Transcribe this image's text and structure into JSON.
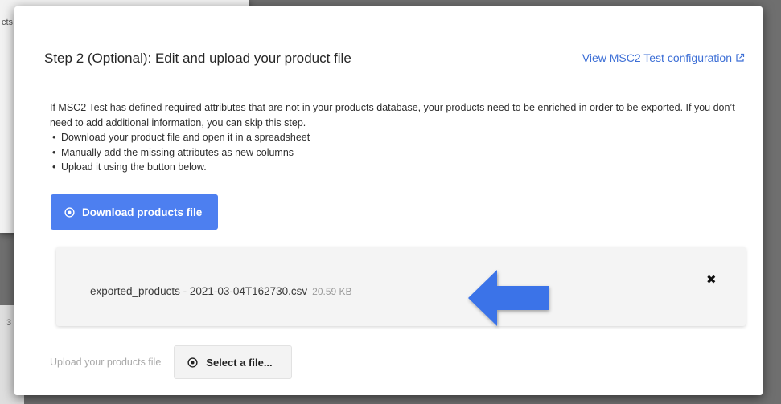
{
  "background": {
    "window_text": "cts",
    "lower_char": "3"
  },
  "step": {
    "title": "Step 2 (Optional): Edit and upload your product file",
    "config_link": "View MSC2 Test configuration"
  },
  "description": {
    "intro": "If MSC2 Test has defined required attributes that are not in your products database, your products need to be enriched in order to be exported. If you don’t need to add additional information, you can skip this step.",
    "bullets": [
      "Download your product file and open it in a spreadsheet",
      "Manually add the missing attributes as new columns",
      "Upload it using the button below."
    ]
  },
  "download_button": {
    "label": "Download products file",
    "icon": "download-circle-icon"
  },
  "file": {
    "name": "exported_products - 2021-03-04T162730.csv",
    "size": "20.59 KB",
    "remove_icon": "close-icon"
  },
  "annotation": {
    "arrow_color": "#3a73e8"
  },
  "upload": {
    "label": "Upload your products file",
    "button_label": "Select a file...",
    "icon": "upload-circle-icon"
  },
  "colors": {
    "accent": "#4d7ff0",
    "link": "#3d6fd6"
  }
}
